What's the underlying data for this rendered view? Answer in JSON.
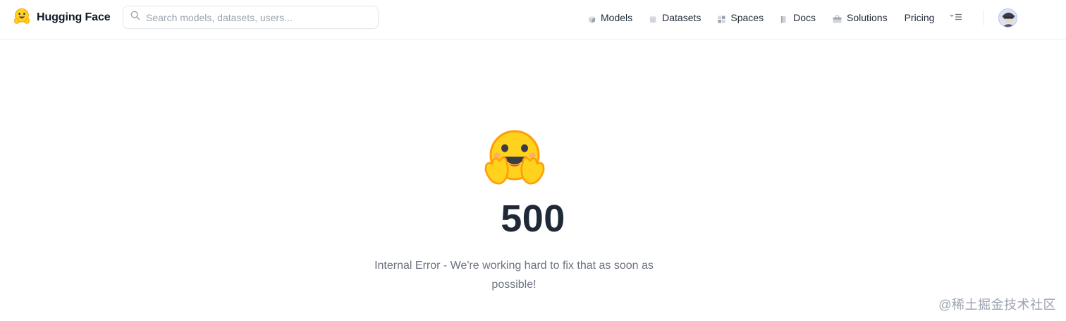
{
  "header": {
    "brand": {
      "name": "Hugging Face",
      "icon": "hugging-face-logo-icon"
    },
    "search": {
      "placeholder": "Search models, datasets, users...",
      "value": ""
    },
    "nav": [
      {
        "label": "Models",
        "icon": "cube-icon",
        "icon_color": "#9ca3af"
      },
      {
        "label": "Datasets",
        "icon": "database-icon",
        "icon_color": "#9ca3af"
      },
      {
        "label": "Spaces",
        "icon": "grid-icon",
        "icon_color": "#9ca3af"
      },
      {
        "label": "Docs",
        "icon": "book-icon",
        "icon_color": "#9ca3af"
      },
      {
        "label": "Solutions",
        "icon": "briefcase-icon",
        "icon_color": "#9ca3af"
      },
      {
        "label": "Pricing"
      }
    ],
    "menu_icon": "more-menu-icon",
    "avatar": {
      "icon": "user-avatar-icon",
      "border_color": "#c4b5fd"
    }
  },
  "error": {
    "icon": "hugging-face-emoji-icon",
    "code": "500",
    "message": "Internal Error - We're working hard to fix that as soon as possible!"
  },
  "watermark": "@稀土掘金技术社区",
  "colors": {
    "emoji_face": "#FFD21E",
    "emoji_outline": "#FF9D0B",
    "heading": "#1f2937",
    "muted_text": "#6b7280"
  }
}
